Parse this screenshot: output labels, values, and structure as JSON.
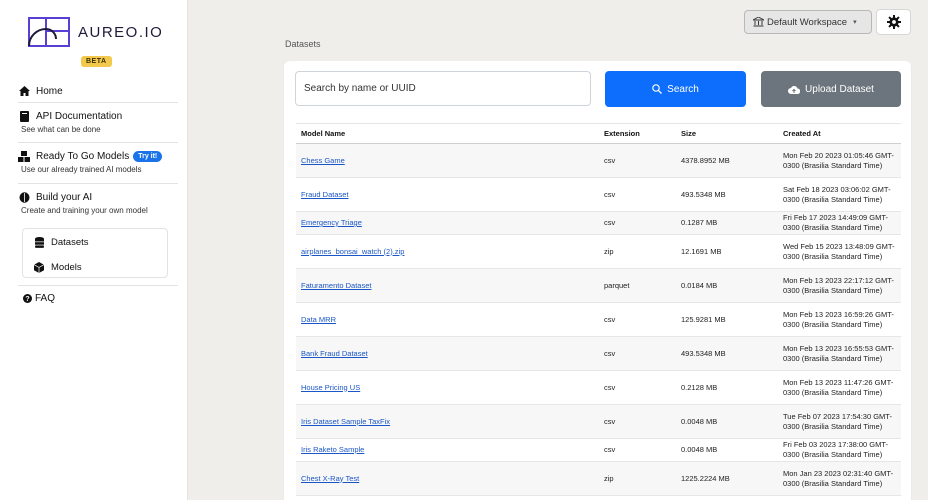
{
  "brand": {
    "name": "AUREO.IO",
    "badge": "BETA"
  },
  "nav": {
    "home": "Home",
    "api_docs": "API Documentation",
    "api_docs_sub": "See what can be done",
    "ready": "Ready To Go Models",
    "ready_badge": "Try it!",
    "ready_sub": "Use our already trained AI models",
    "build": "Build your AI",
    "build_sub": "Create and training your own model",
    "datasets": "Datasets",
    "models": "Models",
    "faq": "FAQ"
  },
  "header": {
    "workspace": "Default Workspace"
  },
  "page": {
    "title": "Datasets"
  },
  "search": {
    "placeholder": "Search by name or UUID",
    "search_label": "Search",
    "upload_label": "Upload Dataset"
  },
  "table": {
    "columns": [
      "Model Name",
      "Extension",
      "Size",
      "Created At"
    ],
    "rows": [
      {
        "name": "Chess Game",
        "ext": "csv",
        "size": "4378.8952 MB",
        "created": "Mon Feb 20 2023 01:05:46 GMT-0300 (Brasilia Standard Time)"
      },
      {
        "name": "Fraud Dataset",
        "ext": "csv",
        "size": "493.5348 MB",
        "created": "Sat Feb 18 2023 03:06:02 GMT-0300 (Brasilia Standard Time)"
      },
      {
        "name": "Emergency Triage",
        "ext": "csv",
        "size": "0.1287 MB",
        "created": "Fri Feb 17 2023 14:49:09 GMT-0300 (Brasilia Standard Time)"
      },
      {
        "name": "airplanes_bonsai_watch (2).zip",
        "ext": "zip",
        "size": "12.1691 MB",
        "created": "Wed Feb 15 2023 13:48:09 GMT-0300 (Brasilia Standard Time)"
      },
      {
        "name": "Faturamento Dataset",
        "ext": "parquet",
        "size": "0.0184 MB",
        "created": "Mon Feb 13 2023 22:17:12 GMT-0300 (Brasilia Standard Time)"
      },
      {
        "name": "Data MRR",
        "ext": "csv",
        "size": "125.9281 MB",
        "created": "Mon Feb 13 2023 16:59:26 GMT-0300 (Brasilia Standard Time)"
      },
      {
        "name": "Bank Fraud Dataset",
        "ext": "csv",
        "size": "493.5348 MB",
        "created": "Mon Feb 13 2023 16:55:53 GMT-0300 (Brasilia Standard Time)"
      },
      {
        "name": "House Pricing US",
        "ext": "csv",
        "size": "0.2128 MB",
        "created": "Mon Feb 13 2023 11:47:26 GMT-0300 (Brasilia Standard Time)"
      },
      {
        "name": "Iris Dataset Sample TaxFix",
        "ext": "csv",
        "size": "0.0048 MB",
        "created": "Tue Feb 07 2023 17:54:30 GMT-0300 (Brasilia Standard Time)"
      },
      {
        "name": "Iris Raketo Sample",
        "ext": "csv",
        "size": "0.0048 MB",
        "created": "Fri Feb 03 2023 17:38:00 GMT-0300 (Brasilia Standard Time)"
      },
      {
        "name": "Chest X-Ray Test",
        "ext": "zip",
        "size": "1225.2224 MB",
        "created": "Mon Jan 23 2023 02:31:40 GMT-0300 (Brasilia Standard Time)"
      }
    ]
  },
  "colors": {
    "primary": "#0d6efd",
    "secondary": "#6c757d",
    "badge": "#f2c94c",
    "link": "#1a56c5"
  }
}
